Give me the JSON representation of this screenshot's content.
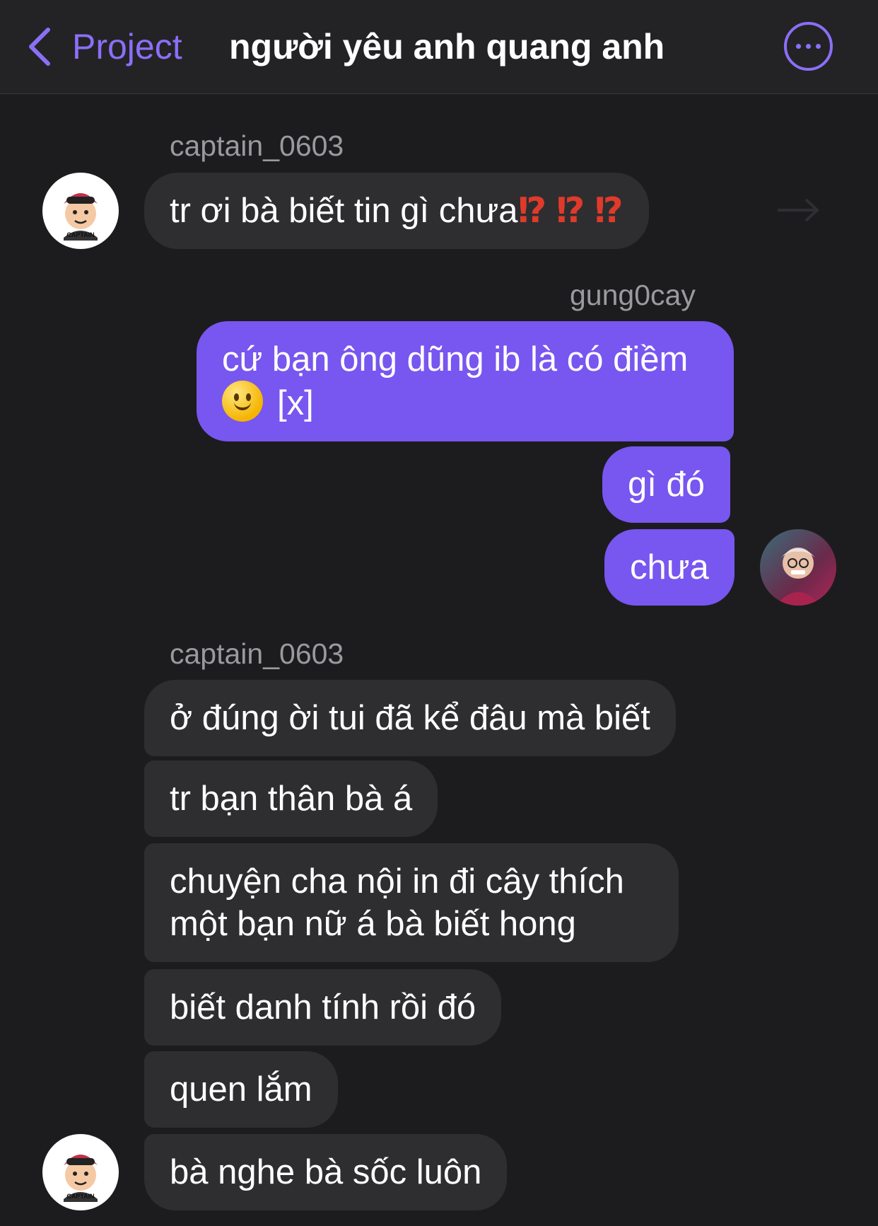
{
  "header": {
    "back_label": "Project",
    "title": "người yêu anh quang anh"
  },
  "captain_badge": "CAPTAIN",
  "messages": [
    {
      "sender": "captain_0603",
      "text": "tr ơi bà biết tin gì chưa",
      "emoji": "⁉ ⁉ ⁉"
    },
    {
      "sender": "gung0cay",
      "line1": "cứ bạn ông dũng ib là có điềm",
      "line2": "[x]"
    },
    {
      "text": "gì đó"
    },
    {
      "text": "chưa"
    },
    {
      "sender": "captain_0603",
      "text": "ở đúng ời tui đã kể đâu mà biết"
    },
    {
      "text": "tr bạn thân bà á"
    },
    {
      "line1": "chuyện cha nội in đi cây thích",
      "line2": "một bạn nữ á bà biết hong"
    },
    {
      "text": "biết danh tính rồi đó"
    },
    {
      "text": "quen lắm"
    },
    {
      "text": "bà nghe bà sốc luôn"
    }
  ],
  "colors": {
    "background": "#1c1c1e",
    "header": "#232325",
    "accent": "#8b6ff7",
    "outgoing_bubble": "#7856f0",
    "incoming_bubble": "#2e2e31",
    "sender_name": "#9a9a9e",
    "alarm_emoji": "#e03a2a"
  },
  "icons": {
    "back": "chevron-left-icon",
    "more": "ellipsis-circle-icon",
    "forward": "forward-arrow-icon",
    "smiley": "slightly-smiling-face-emoji"
  }
}
